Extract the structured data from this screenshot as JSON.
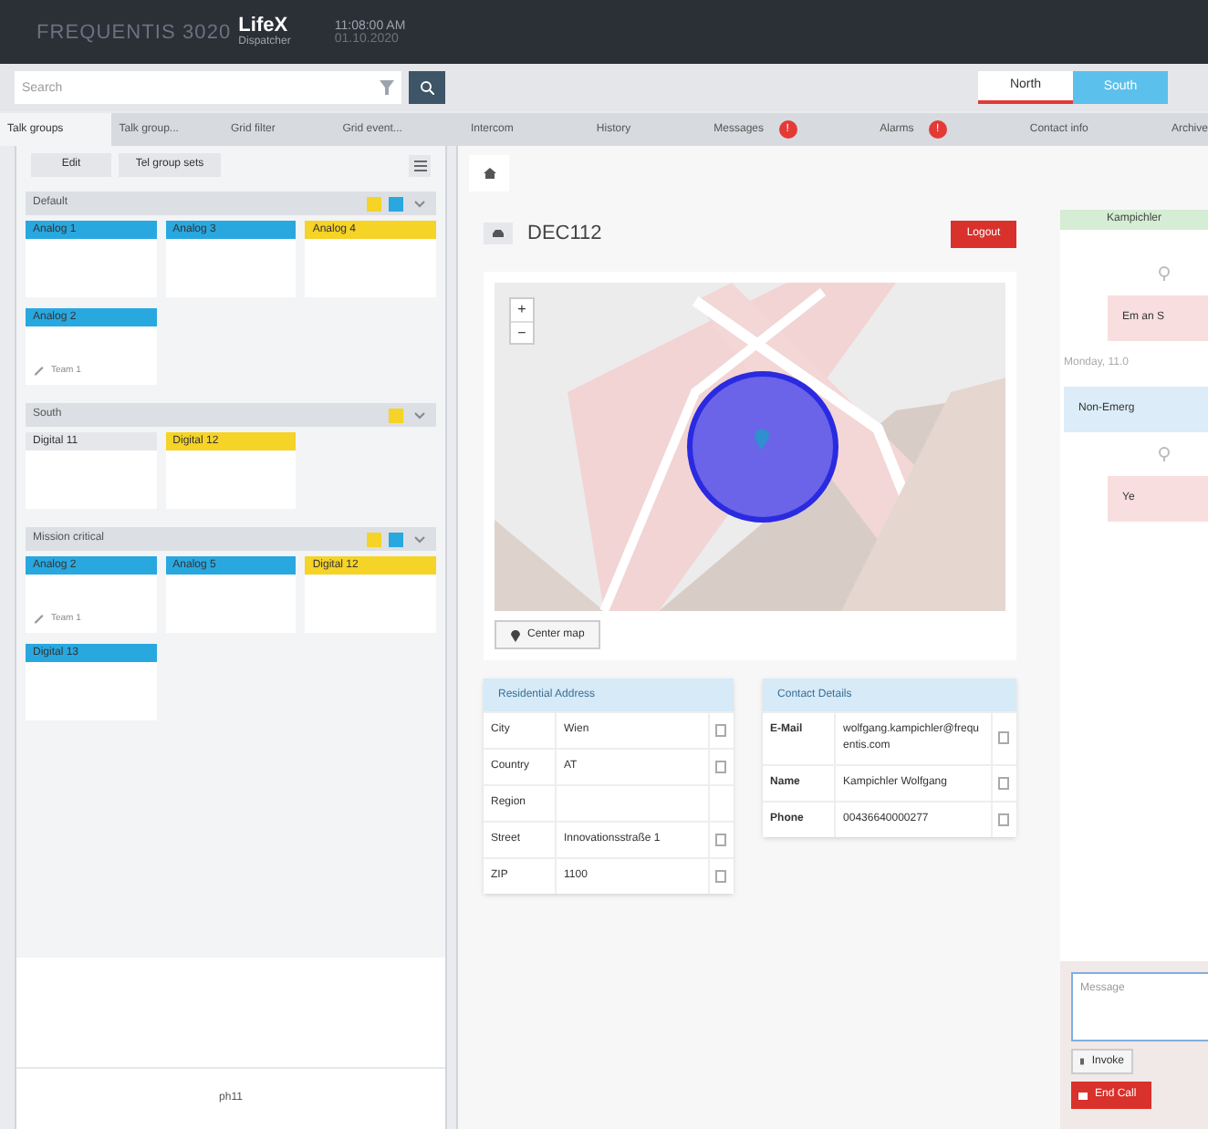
{
  "header": {
    "brand": "FREQUENTIS 3020",
    "product": "LifeX",
    "role": "Dispatcher",
    "clock": "11:08:00 AM",
    "date": "01.10.2020"
  },
  "search": {
    "placeholder": "Search"
  },
  "sites": [
    {
      "label": "North",
      "selected": true
    },
    {
      "label": "South",
      "selected": false
    }
  ],
  "left_tabs": [
    {
      "label": "Talk groups",
      "selected": true
    },
    {
      "label": "Talk group...",
      "selected": false
    },
    {
      "label": "Grid filter",
      "selected": false
    },
    {
      "label": "Grid event...",
      "selected": false
    }
  ],
  "main_tabs": [
    {
      "label": "Intercom"
    },
    {
      "label": "History"
    },
    {
      "label": "Messages",
      "badge": "!"
    },
    {
      "label": "Alarms",
      "badge": "!"
    },
    {
      "label": "Contact info"
    },
    {
      "label": "Archive"
    }
  ],
  "toolbar": {
    "edit": "Edit",
    "sets": "Tel group sets"
  },
  "groups": [
    {
      "name": "Default",
      "colors": [
        {
          "color": "#f5d327"
        },
        {
          "color": "#29a8e0"
        }
      ],
      "expanded": true,
      "tiles": [
        {
          "label": "Analog 1",
          "color": "#29a8e0"
        },
        {
          "label": "Analog 3",
          "color": "#29a8e0"
        },
        {
          "label": "Analog 4",
          "color": "#f5d327"
        },
        {
          "label": "Analog 2",
          "color": "#29a8e0",
          "member": "Team 1"
        }
      ]
    },
    {
      "name": "South",
      "colors": [
        {
          "color": "#f5d327"
        }
      ],
      "expanded": true,
      "tiles": [
        {
          "label": "Digital 11",
          "color": "#e5e7eb"
        },
        {
          "label": "Digital 12",
          "color": "#f5d327"
        }
      ]
    },
    {
      "name": "Mission critical",
      "colors": [
        {
          "color": "#f5d327"
        },
        {
          "color": "#29a8e0"
        }
      ],
      "expanded": true,
      "tiles": [
        {
          "label": "Analog 2",
          "color": "#29a8e0",
          "member": "Team 1"
        },
        {
          "label": "Analog 5",
          "color": "#29a8e0"
        },
        {
          "label": "Digital 12",
          "color": "#f5d327"
        },
        {
          "label": "Digital 13",
          "color": "#29a8e0"
        }
      ]
    }
  ],
  "left_footer": "ph11",
  "caller": {
    "id": "DEC112",
    "logout": "Logout"
  },
  "map": {
    "kind": "picture",
    "zoom_in": "+",
    "zoom_out": "−",
    "center": "Center map"
  },
  "address": {
    "title": "Residential Address",
    "rows": [
      {
        "label": "City",
        "value": "Wien"
      },
      {
        "label": "Country",
        "value": "AT"
      },
      {
        "label": "Region"
      },
      {
        "label": "Street",
        "value": "Innovationsstraße 1"
      },
      {
        "label": "ZIP",
        "value": "1100"
      }
    ]
  },
  "contact": {
    "title": "Contact Details",
    "rows": [
      {
        "label": "E-Mail",
        "value": "wolfgang.kampichler@frequentis.com"
      },
      {
        "label": "Name",
        "value": "Kampichler Wolfgang"
      },
      {
        "label": "Phone",
        "value": "00436640000277"
      }
    ]
  },
  "chat": {
    "title": "Kampichler",
    "messages": [
      {
        "kind": "incoming",
        "text": "Em an S"
      },
      {
        "kind": "date",
        "text": "Monday, 11.0"
      },
      {
        "kind": "outgoing",
        "text": "Non-Emerg"
      },
      {
        "kind": "incoming",
        "text": "Ye"
      }
    ],
    "placeholder": "Message",
    "invoke": "Invoke",
    "end": "End Call"
  }
}
